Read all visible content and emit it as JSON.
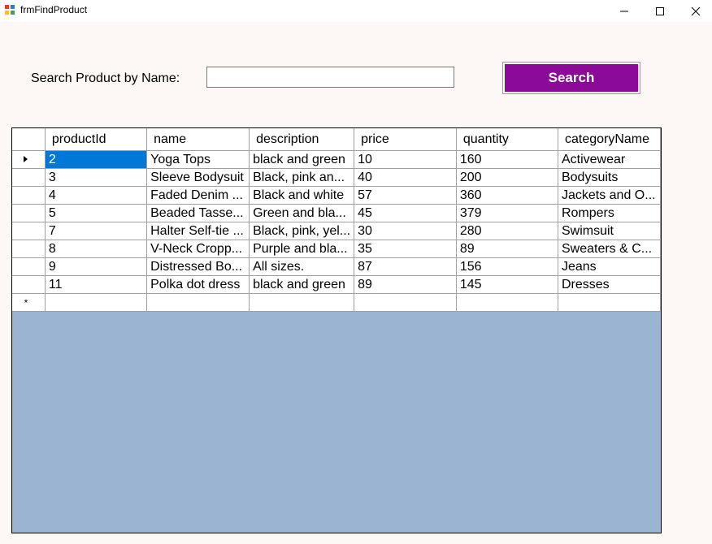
{
  "window": {
    "title": "frmFindProduct",
    "controls": {
      "minimize": "minimize-icon",
      "maximize": "maximize-icon",
      "close": "close-icon"
    }
  },
  "search": {
    "label": "Search Product by Name:",
    "value": "",
    "placeholder": "",
    "button_label": "Search",
    "button_color": "#8b0a98"
  },
  "grid": {
    "columns": [
      "productId",
      "name",
      "description",
      "price",
      "quantity",
      "categoryName"
    ],
    "rows": [
      [
        "2",
        "Yoga Tops",
        "black and green",
        "10",
        "160",
        "Activewear"
      ],
      [
        "3",
        "Sleeve Bodysuit",
        "Black, pink an...",
        "40",
        "200",
        "Bodysuits"
      ],
      [
        "4",
        "Faded Denim ...",
        "Black and white",
        "57",
        "360",
        "Jackets and O..."
      ],
      [
        "5",
        "Beaded Tasse...",
        "Green and bla...",
        "45",
        "379",
        "Rompers"
      ],
      [
        "7",
        "Halter Self-tie ...",
        "Black, pink, yel...",
        "30",
        "280",
        "Swimsuit"
      ],
      [
        "8",
        "V-Neck Cropp...",
        "Purple and bla...",
        "35",
        "89",
        "Sweaters & C..."
      ],
      [
        "9",
        "Distressed Bo...",
        "All sizes.",
        "87",
        "156",
        "Jeans"
      ],
      [
        "11",
        "Polka dot dress",
        "black and green",
        "89",
        "145",
        "Dresses"
      ]
    ],
    "current_row_marker": "current-row-arrow-icon",
    "new_row_marker": "*",
    "selection_color": "#0078d7",
    "background_color": "#9ab4d2"
  }
}
